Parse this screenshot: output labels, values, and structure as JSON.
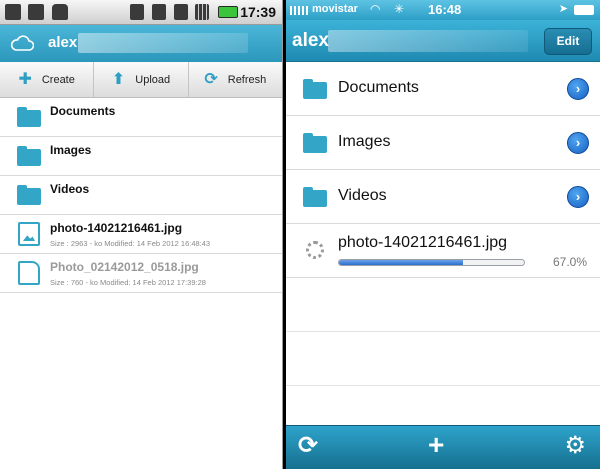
{
  "android": {
    "status": {
      "time": "17:39"
    },
    "header": {
      "title": "alex"
    },
    "toolbar": [
      {
        "label": "Create",
        "icon": "plus-icon"
      },
      {
        "label": "Upload",
        "icon": "upload-arrow-icon"
      },
      {
        "label": "Refresh",
        "icon": "refresh-icon"
      }
    ],
    "folders": [
      "Documents",
      "Images",
      "Videos"
    ],
    "files": [
      {
        "name": "photo-14021216461.jpg",
        "meta": "Size : 2963 - ko Modified: 14 Feb 2012 16:48:43",
        "icon": "image-file-icon"
      },
      {
        "name": "Photo_02142012_0518.jpg",
        "meta": "Size : 760 - ko Modified: 14 Feb 2012 17:39:28",
        "icon": "document-file-icon"
      }
    ]
  },
  "ios": {
    "status": {
      "carrier": "movistar",
      "time": "16:48"
    },
    "nav": {
      "title": "alex",
      "edit_label": "Edit"
    },
    "folders": [
      "Documents",
      "Images",
      "Videos"
    ],
    "upload": {
      "name": "photo-14021216461.jpg",
      "progress_percent": 67.0,
      "progress_label": "67.0%"
    },
    "tabbar": [
      "refresh-icon",
      "plus-icon",
      "gears-icon"
    ]
  },
  "colors": {
    "accent": "#33a6c7",
    "header": "#2b97bb",
    "progress": "#2b6fd0"
  }
}
